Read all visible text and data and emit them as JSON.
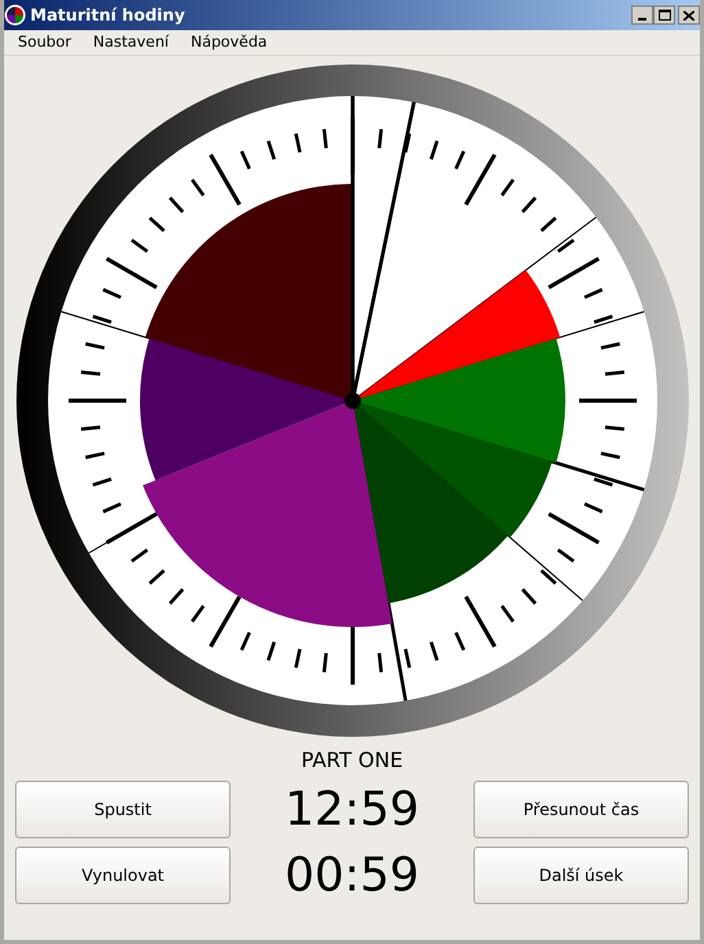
{
  "window": {
    "title": "Maturitní hodiny"
  },
  "menu": [
    "Soubor",
    "Nastavení",
    "Nápověda"
  ],
  "part_label": "PART ONE",
  "left_buttons": [
    "Spustit",
    "Vynulovat"
  ],
  "times": [
    "12:59",
    "00:59"
  ],
  "right_buttons": [
    "Přesunout čas",
    "Další úsek"
  ]
}
